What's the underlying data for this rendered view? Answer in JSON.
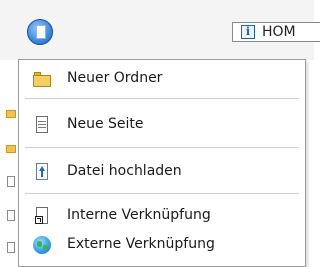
{
  "toolbar": {
    "new_button_icon": "new-page-icon",
    "home_label": "HOM",
    "home_icon": "info-icon"
  },
  "menu": {
    "items": [
      {
        "label": "Neuer Ordner",
        "icon": "folder-icon"
      },
      {
        "label": "Neue Seite",
        "icon": "page-icon"
      },
      {
        "label": "Datei hochladen",
        "icon": "upload-icon"
      },
      {
        "label": "Interne Verknüpfung",
        "icon": "internal-link-icon"
      },
      {
        "label": "Externe Verknüpfung",
        "icon": "globe-icon"
      }
    ]
  },
  "colors": {
    "menu_border": "#9d9d9d",
    "separator": "#cfcfcf",
    "accent_blue": "#1f5fb8",
    "folder_yellow": "#f5cf5f"
  }
}
